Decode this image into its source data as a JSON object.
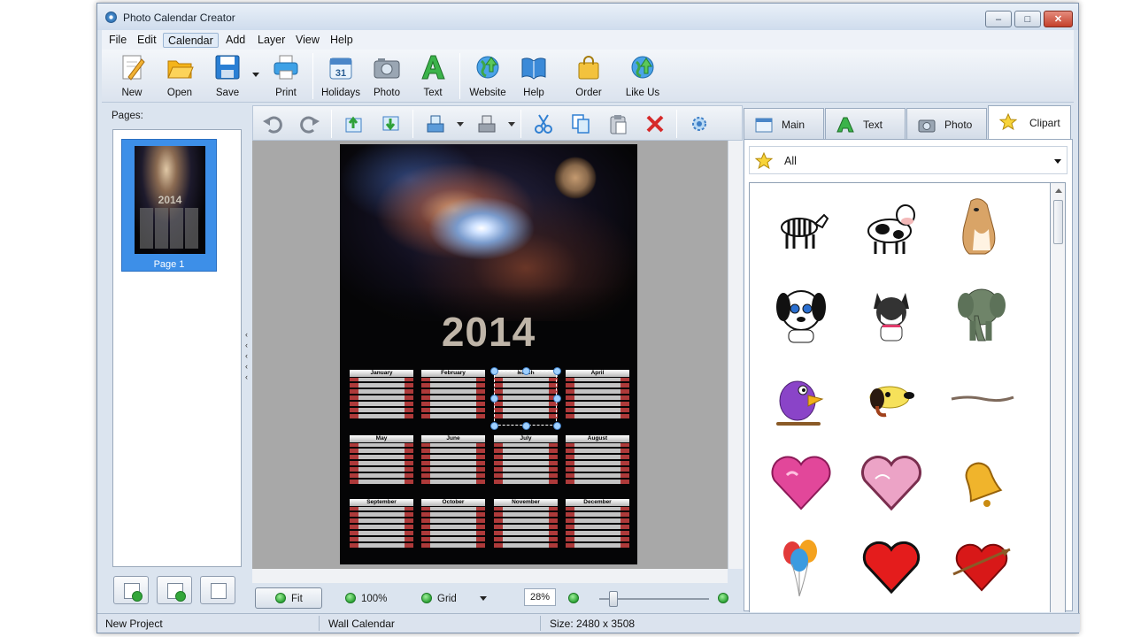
{
  "window": {
    "title": "Photo Calendar Creator"
  },
  "menu": [
    "File",
    "Edit",
    "Calendar",
    "Add",
    "Layer",
    "View",
    "Help"
  ],
  "toolbar": {
    "new": "New",
    "open": "Open",
    "save": "Save",
    "print": "Print",
    "holidays": "Holidays",
    "photo": "Photo",
    "text": "Text",
    "website": "Website",
    "help": "Help",
    "order": "Order",
    "like_us": "Like Us",
    "holidays_icon_day": "31"
  },
  "pages": {
    "label": "Pages:",
    "items": [
      {
        "label": "Page 1",
        "thumb_year": "2014"
      }
    ]
  },
  "poster": {
    "year": "2014",
    "months": [
      "January",
      "February",
      "March",
      "April",
      "May",
      "June",
      "July",
      "August",
      "September",
      "October",
      "November",
      "December"
    ]
  },
  "canvas_bottom": {
    "fit": "Fit",
    "zoom_100": "100%",
    "grid": "Grid",
    "zoom_value": "28%"
  },
  "right_panel": {
    "tabs": [
      "Main",
      "Text",
      "Photo",
      "Clipart"
    ],
    "active_tab": "Clipart",
    "category": "All",
    "clipart": [
      "zebra",
      "cow",
      "collie-dog",
      "dalmatian-puppy",
      "husky-puppy",
      "elephant",
      "purple-bird",
      "dachshund",
      "rope",
      "pink-heart",
      "glitter-heart",
      "bell",
      "balloons",
      "red-heart",
      "heart-with-arrow"
    ]
  },
  "status": {
    "project": "New Project",
    "type": "Wall Calendar",
    "size": "Size: 2480 x 3508"
  }
}
